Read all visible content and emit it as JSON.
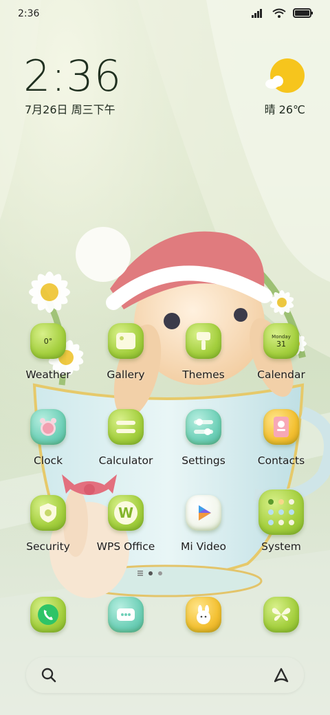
{
  "status_bar": {
    "time": "2:36",
    "icons": [
      "signal-icon",
      "wifi-icon",
      "battery-icon"
    ]
  },
  "clock_widget": {
    "time": "2:36",
    "date": "7月26日 周三下午"
  },
  "weather_widget": {
    "icon": "sun-cloud-icon",
    "condition_temp": "晴 26℃"
  },
  "apps": {
    "weather": {
      "label": "Weather",
      "icon_text": "0°"
    },
    "gallery": {
      "label": "Gallery"
    },
    "themes": {
      "label": "Themes"
    },
    "calendar": {
      "label": "Calendar",
      "icon_month": "Monday",
      "icon_day": "31"
    },
    "clock": {
      "label": "Clock"
    },
    "calculator": {
      "label": "Calculator"
    },
    "settings": {
      "label": "Settings"
    },
    "contacts": {
      "label": "Contacts"
    },
    "security": {
      "label": "Security"
    },
    "wps": {
      "label": "WPS Office",
      "icon_text": "W"
    },
    "mivideo": {
      "label": "Mi Video"
    },
    "system": {
      "label": "System"
    }
  },
  "dock": [
    "phone-icon",
    "messages-icon",
    "bunny-app-icon",
    "butterfly-app-icon"
  ],
  "page_indicator": {
    "pages": 2,
    "current": 1
  },
  "colors": {
    "icon_green": "#a4cf3e",
    "icon_teal": "#6fd0b8",
    "icon_gold": "#f3c032",
    "sun": "#f6c51d"
  }
}
